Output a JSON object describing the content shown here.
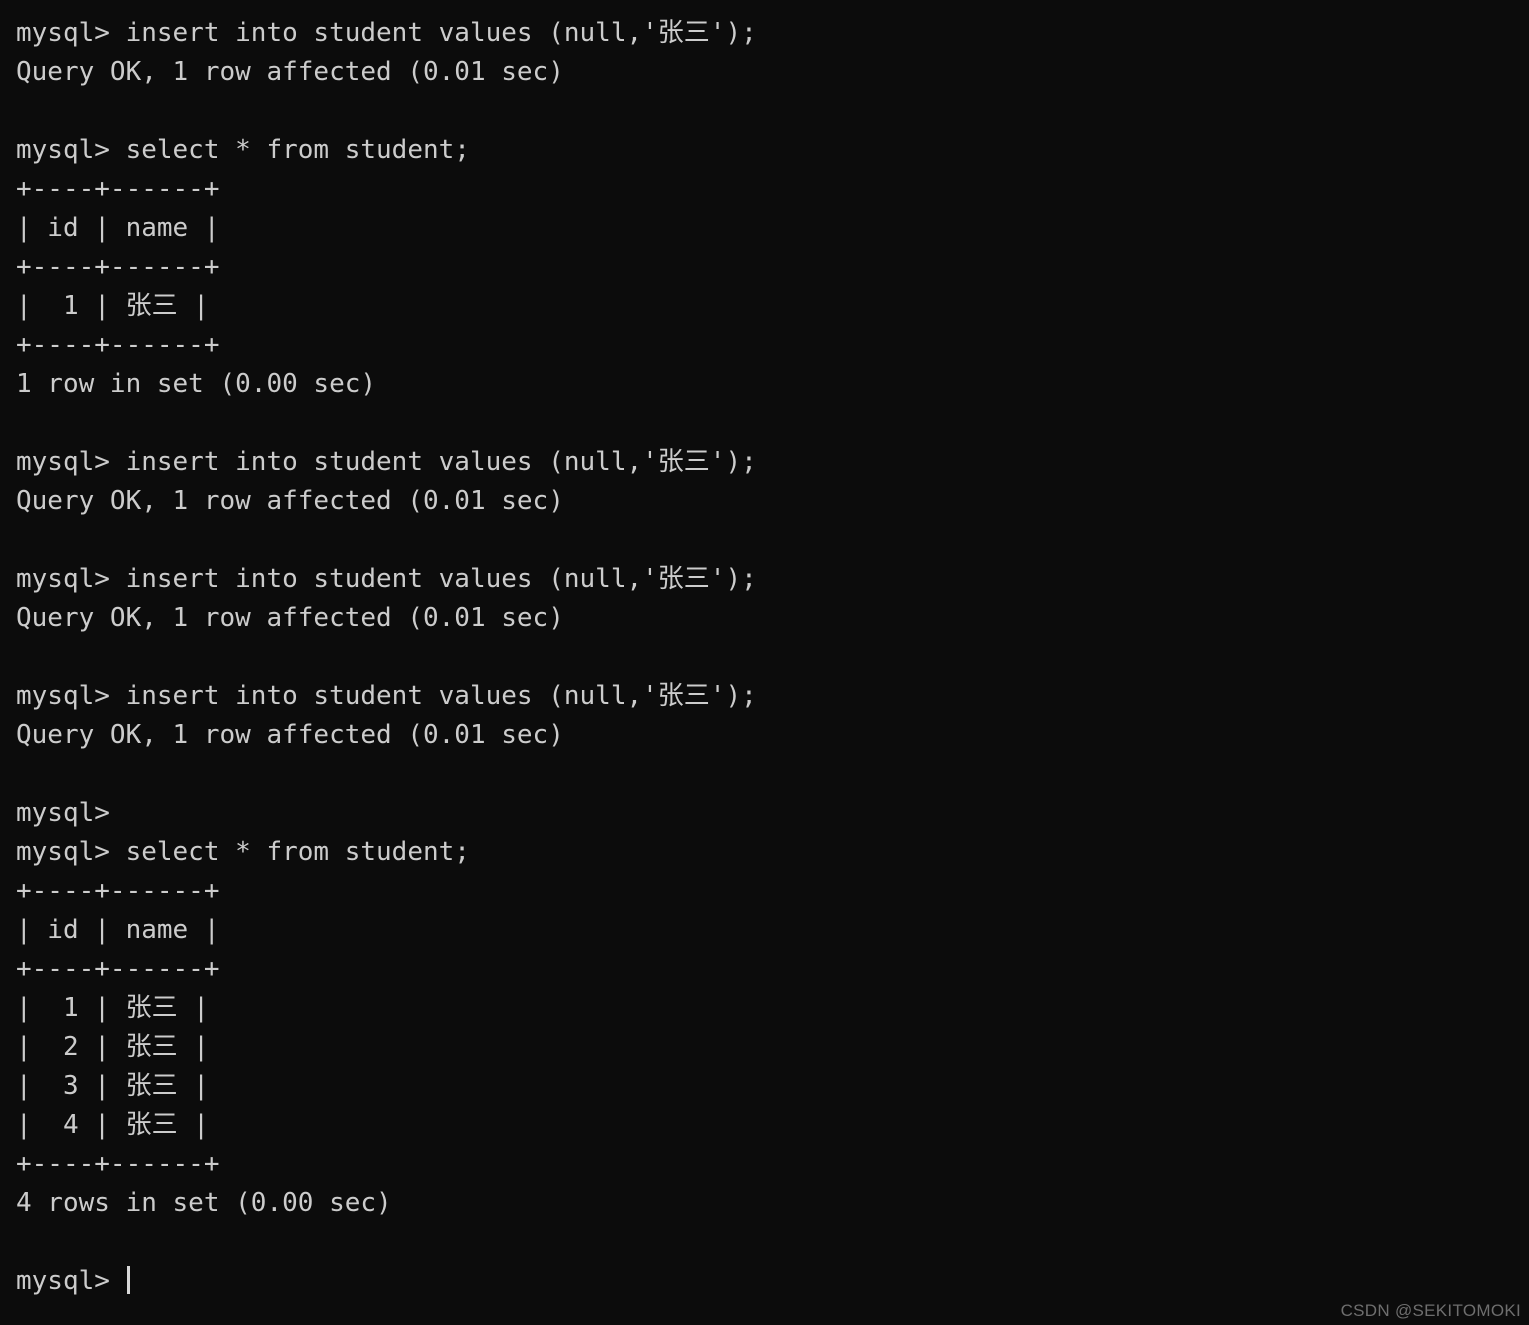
{
  "terminal": {
    "background_color": "#0c0c0c",
    "text_color": "#cccccc",
    "prompt": "mysql>",
    "cursor_visible": true,
    "lines": [
      "mysql> insert into student values (null,'张三');",
      "Query OK, 1 row affected (0.01 sec)",
      "",
      "mysql> select * from student;",
      "+----+------+",
      "| id | name |",
      "+----+------+",
      "|  1 | 张三 |",
      "+----+------+",
      "1 row in set (0.00 sec)",
      "",
      "mysql> insert into student values (null,'张三');",
      "Query OK, 1 row affected (0.01 sec)",
      "",
      "mysql> insert into student values (null,'张三');",
      "Query OK, 1 row affected (0.01 sec)",
      "",
      "mysql> insert into student values (null,'张三');",
      "Query OK, 1 row affected (0.01 sec)",
      "",
      "mysql>",
      "mysql> select * from student;",
      "+----+------+",
      "| id | name |",
      "+----+------+",
      "|  1 | 张三 |",
      "|  2 | 张三 |",
      "|  3 | 张三 |",
      "|  4 | 张三 |",
      "+----+------+",
      "4 rows in set (0.00 sec)",
      ""
    ],
    "final_prompt": "mysql> ",
    "result_tables": [
      {
        "columns": [
          "id",
          "name"
        ],
        "rows": [
          [
            "1",
            "张三"
          ]
        ],
        "footer": "1 row in set (0.00 sec)"
      },
      {
        "columns": [
          "id",
          "name"
        ],
        "rows": [
          [
            "1",
            "张三"
          ],
          [
            "2",
            "张三"
          ],
          [
            "3",
            "张三"
          ],
          [
            "4",
            "张三"
          ]
        ],
        "footer": "4 rows in set (0.00 sec)"
      }
    ],
    "commands": [
      "insert into student values (null,'张三');",
      "select * from student;",
      "insert into student values (null,'张三');",
      "insert into student values (null,'张三');",
      "insert into student values (null,'张三');",
      "select * from student;"
    ],
    "status_messages": [
      "Query OK, 1 row affected (0.01 sec)",
      "1 row in set (0.00 sec)",
      "Query OK, 1 row affected (0.01 sec)",
      "Query OK, 1 row affected (0.01 sec)",
      "Query OK, 1 row affected (0.01 sec)",
      "4 rows in set (0.00 sec)"
    ]
  },
  "watermark": {
    "text": "CSDN @SEKITOMOKI",
    "color": "#6e6e6e"
  }
}
